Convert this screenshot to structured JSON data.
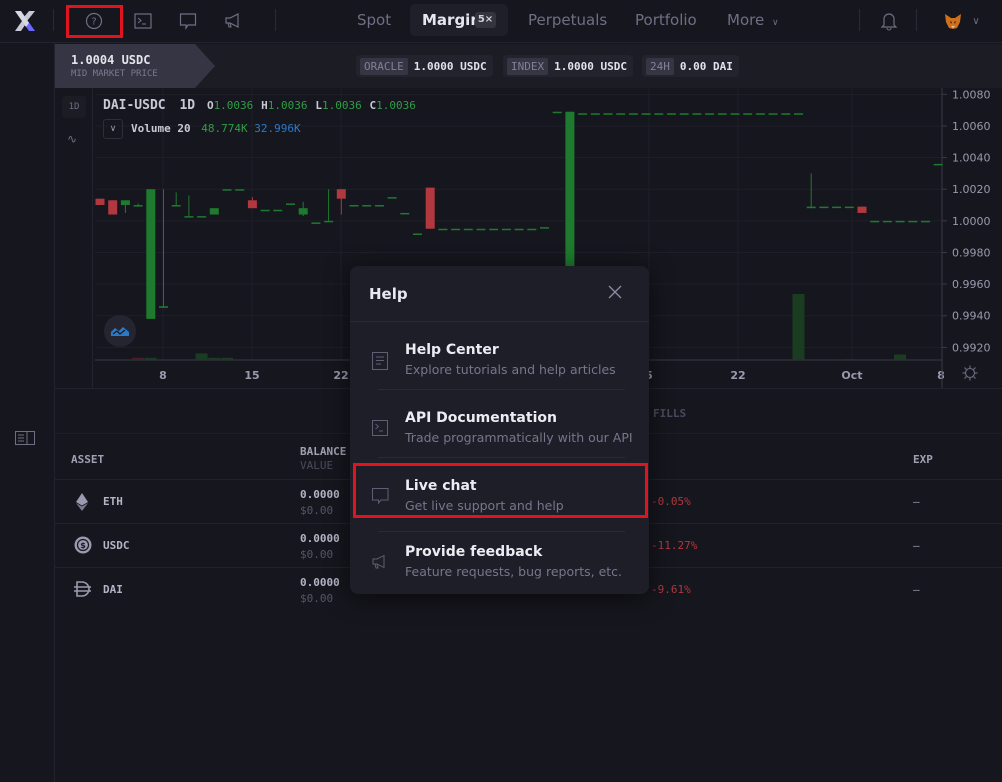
{
  "topbar": {
    "logo": "dydx-logo",
    "icons": [
      "help-icon",
      "terminal-icon",
      "chat-icon",
      "megaphone-icon"
    ],
    "nav": [
      {
        "label": "Spot"
      },
      {
        "label": "Margin",
        "badge": "5×",
        "active": true
      },
      {
        "label": "Perpetuals"
      },
      {
        "label": "Portfolio"
      },
      {
        "label": "More"
      }
    ],
    "right_icons": [
      "bell-icon",
      "metamask-fox-icon",
      "chevron-down-icon"
    ]
  },
  "market": {
    "mid_price": "1.0004 USDC",
    "mid_price_label": "MID MARKET PRICE",
    "oracle_tag": "ORACLE",
    "oracle_value": "1.0000 USDC",
    "index_tag": "INDEX",
    "index_value": "1.0000 USDC",
    "h24_tag": "24H",
    "h24_value": "0.00 DAI"
  },
  "chart_toolbar": {
    "interval": "1D"
  },
  "chart_data": {
    "type": "candlestick",
    "title": "DAI-USDC",
    "interval": "1D",
    "ohlc_legend": {
      "O": "1.0036",
      "H": "1.0036",
      "L": "1.0036",
      "C": "1.0036"
    },
    "volume_label": "Volume 20",
    "volume_values": [
      "48.774K",
      "32.996K"
    ],
    "y_ticks": [
      "1.0080",
      "1.0060",
      "1.0040",
      "1.0020",
      "1.0000",
      "0.9980",
      "0.9960",
      "0.9940",
      "0.9920"
    ],
    "ylim": [
      0.9912,
      1.0084
    ],
    "x_ticks": [
      "8",
      "15",
      "22",
      "5",
      "22",
      "Oct",
      "8"
    ],
    "colors": {
      "up": "#1e7a2e",
      "down": "#b0383e",
      "up_volume": "#1a3d22",
      "down_volume": "#4a1e22"
    },
    "candles": [
      {
        "o": 1.0014,
        "h": 1.0014,
        "l": 1.001,
        "c": 1.001
      },
      {
        "o": 1.0013,
        "h": 1.0013,
        "l": 1.0004,
        "c": 1.0004
      },
      {
        "o": 1.001,
        "h": 1.0013,
        "l": 1.0005,
        "c": 1.0013
      },
      {
        "o": 1.0009,
        "h": 1.0011,
        "l": 1.0009,
        "c": 1.001
      },
      {
        "o": 0.9938,
        "h": 1.002,
        "l": 0.9938,
        "c": 1.002
      },
      {
        "o": 0.9945,
        "h": 1.002,
        "l": 0.9945,
        "c": 0.9946
      },
      {
        "o": 1.001,
        "h": 1.0018,
        "l": 1.001,
        "c": 1.001
      },
      {
        "o": 1.0003,
        "h": 1.0016,
        "l": 1.0003,
        "c": 1.0003
      },
      {
        "o": 1.0003,
        "h": 1.0003,
        "l": 1.0003,
        "c": 1.0003
      },
      {
        "o": 1.0004,
        "h": 1.0008,
        "l": 1.0004,
        "c": 1.0008
      },
      {
        "o": 1.002,
        "h": 1.002,
        "l": 1.002,
        "c": 1.002
      },
      {
        "o": 1.002,
        "h": 1.002,
        "l": 1.002,
        "c": 1.002
      },
      {
        "o": 1.0013,
        "h": 1.0015,
        "l": 1.0008,
        "c": 1.0008
      },
      {
        "o": 1.0007,
        "h": 1.0007,
        "l": 1.0007,
        "c": 1.0007
      },
      {
        "o": 1.0007,
        "h": 1.0007,
        "l": 1.0007,
        "c": 1.0007
      },
      {
        "o": 1.0011,
        "h": 1.0011,
        "l": 1.0011,
        "c": 1.0011
      },
      {
        "o": 1.0004,
        "h": 1.0012,
        "l": 1.0003,
        "c": 1.0008
      },
      {
        "o": 0.9999,
        "h": 0.9999,
        "l": 0.9999,
        "c": 0.9999
      },
      {
        "o": 1.0,
        "h": 1.002,
        "l": 1.0,
        "c": 1.0
      },
      {
        "o": 1.002,
        "h": 1.002,
        "l": 1.0004,
        "c": 1.0014
      },
      {
        "o": 1.001,
        "h": 1.001,
        "l": 1.001,
        "c": 1.001
      },
      {
        "o": 1.001,
        "h": 1.001,
        "l": 1.001,
        "c": 1.001
      },
      {
        "o": 1.001,
        "h": 1.001,
        "l": 1.001,
        "c": 1.001
      },
      {
        "o": 1.0015,
        "h": 1.0015,
        "l": 1.0015,
        "c": 1.0015
      },
      {
        "o": 1.0005,
        "h": 1.0005,
        "l": 1.0005,
        "c": 1.0005
      },
      {
        "o": 0.9992,
        "h": 0.9992,
        "l": 0.9992,
        "c": 0.9992
      },
      {
        "o": 1.0021,
        "h": 1.0021,
        "l": 0.9995,
        "c": 0.9995
      },
      {
        "o": 0.9995,
        "h": 0.9995,
        "l": 0.9995,
        "c": 0.9995
      },
      {
        "o": 0.9995,
        "h": 0.9995,
        "l": 0.9995,
        "c": 0.9995
      },
      {
        "o": 0.9995,
        "h": 0.9995,
        "l": 0.9995,
        "c": 0.9995
      },
      {
        "o": 0.9995,
        "h": 0.9995,
        "l": 0.9995,
        "c": 0.9995
      },
      {
        "o": 0.9995,
        "h": 0.9995,
        "l": 0.9995,
        "c": 0.9995
      },
      {
        "o": 0.9995,
        "h": 0.9995,
        "l": 0.9995,
        "c": 0.9995
      },
      {
        "o": 0.9995,
        "h": 0.9995,
        "l": 0.9995,
        "c": 0.9995
      },
      {
        "o": 0.9995,
        "h": 0.9995,
        "l": 0.9995,
        "c": 0.9995
      },
      {
        "o": 0.9996,
        "h": 0.9996,
        "l": 0.9996,
        "c": 0.9996
      },
      {
        "o": 1.0069,
        "h": 1.0069,
        "l": 1.0069,
        "c": 1.0069
      },
      {
        "o": 0.996,
        "h": 1.0069,
        "l": 0.996,
        "c": 1.0069
      },
      {
        "o": 1.0068,
        "h": 1.0068,
        "l": 1.0068,
        "c": 1.0068
      },
      {
        "o": 1.0068,
        "h": 1.0068,
        "l": 1.0068,
        "c": 1.0068
      },
      {
        "o": 1.0068,
        "h": 1.0068,
        "l": 1.0068,
        "c": 1.0068
      },
      {
        "o": 1.0068,
        "h": 1.0068,
        "l": 1.0068,
        "c": 1.0068
      },
      {
        "o": 1.0068,
        "h": 1.0068,
        "l": 1.0068,
        "c": 1.0068
      },
      {
        "o": 1.0068,
        "h": 1.0068,
        "l": 1.0068,
        "c": 1.0068
      },
      {
        "o": 1.0068,
        "h": 1.0068,
        "l": 1.0068,
        "c": 1.0068
      },
      {
        "o": 1.0068,
        "h": 1.0068,
        "l": 1.0068,
        "c": 1.0068
      },
      {
        "o": 1.0068,
        "h": 1.0068,
        "l": 1.0068,
        "c": 1.0068
      },
      {
        "o": 1.0068,
        "h": 1.0068,
        "l": 1.0068,
        "c": 1.0068
      },
      {
        "o": 1.0068,
        "h": 1.0068,
        "l": 1.0068,
        "c": 1.0068
      },
      {
        "o": 1.0068,
        "h": 1.0068,
        "l": 1.0068,
        "c": 1.0068
      },
      {
        "o": 1.0068,
        "h": 1.0068,
        "l": 1.0068,
        "c": 1.0068
      },
      {
        "o": 1.0068,
        "h": 1.0068,
        "l": 1.0068,
        "c": 1.0068
      },
      {
        "o": 1.0068,
        "h": 1.0068,
        "l": 1.0068,
        "c": 1.0068
      },
      {
        "o": 1.0068,
        "h": 1.0068,
        "l": 1.0068,
        "c": 1.0068
      },
      {
        "o": 1.0068,
        "h": 1.0068,
        "l": 1.0068,
        "c": 1.0068
      },
      {
        "o": 1.0068,
        "h": 1.0068,
        "l": 1.0068,
        "c": 1.0068
      },
      {
        "o": 1.0008,
        "h": 1.003,
        "l": 1.0008,
        "c": 1.0009
      },
      {
        "o": 1.0009,
        "h": 1.0009,
        "l": 1.0009,
        "c": 1.0009
      },
      {
        "o": 1.0009,
        "h": 1.0009,
        "l": 1.0009,
        "c": 1.0009
      },
      {
        "o": 1.0009,
        "h": 1.0009,
        "l": 1.0009,
        "c": 1.0009
      },
      {
        "o": 1.0009,
        "h": 1.0009,
        "l": 1.0005,
        "c": 1.0005
      },
      {
        "o": 1.0,
        "h": 1.0,
        "l": 1.0,
        "c": 1.0
      },
      {
        "o": 1.0,
        "h": 1.0,
        "l": 1.0,
        "c": 1.0
      },
      {
        "o": 1.0,
        "h": 1.0,
        "l": 1.0,
        "c": 1.0
      },
      {
        "o": 1.0,
        "h": 1.0,
        "l": 1.0,
        "c": 1.0
      },
      {
        "o": 1.0,
        "h": 1.0,
        "l": 1.0,
        "c": 1.0
      },
      {
        "o": 1.0036,
        "h": 1.0036,
        "l": 1.0036,
        "c": 1.0036
      }
    ]
  },
  "panel": {
    "tabs": [
      "FILLS"
    ],
    "columns": {
      "asset": "ASSET",
      "balance": "BALANCE",
      "value": "VALUE",
      "exp": "EXP"
    },
    "rows": [
      {
        "asset": "ETH",
        "icon": "eth-icon",
        "balance": "0.0000",
        "value": "$0.00",
        "change": "-0.05%",
        "exp": "–"
      },
      {
        "asset": "USDC",
        "icon": "usdc-icon",
        "balance": "0.0000",
        "value": "$0.00",
        "change": "-11.27%",
        "exp": "–"
      },
      {
        "asset": "DAI",
        "icon": "dai-icon",
        "balance": "0.0000",
        "value": "$0.00",
        "change": "-9.61%",
        "exp": "–"
      }
    ]
  },
  "help_modal": {
    "title": "Help",
    "items": [
      {
        "title": "Help Center",
        "subtitle": "Explore tutorials and help articles",
        "icon": "document-icon"
      },
      {
        "title": "API Documentation",
        "subtitle": "Trade programmatically with our API",
        "icon": "terminal-icon"
      },
      {
        "title": "Live chat",
        "subtitle": "Get live support and help",
        "icon": "chat-icon",
        "highlighted": true
      },
      {
        "title": "Provide feedback",
        "subtitle": "Feature requests, bug reports, etc.",
        "icon": "megaphone-icon"
      }
    ]
  }
}
